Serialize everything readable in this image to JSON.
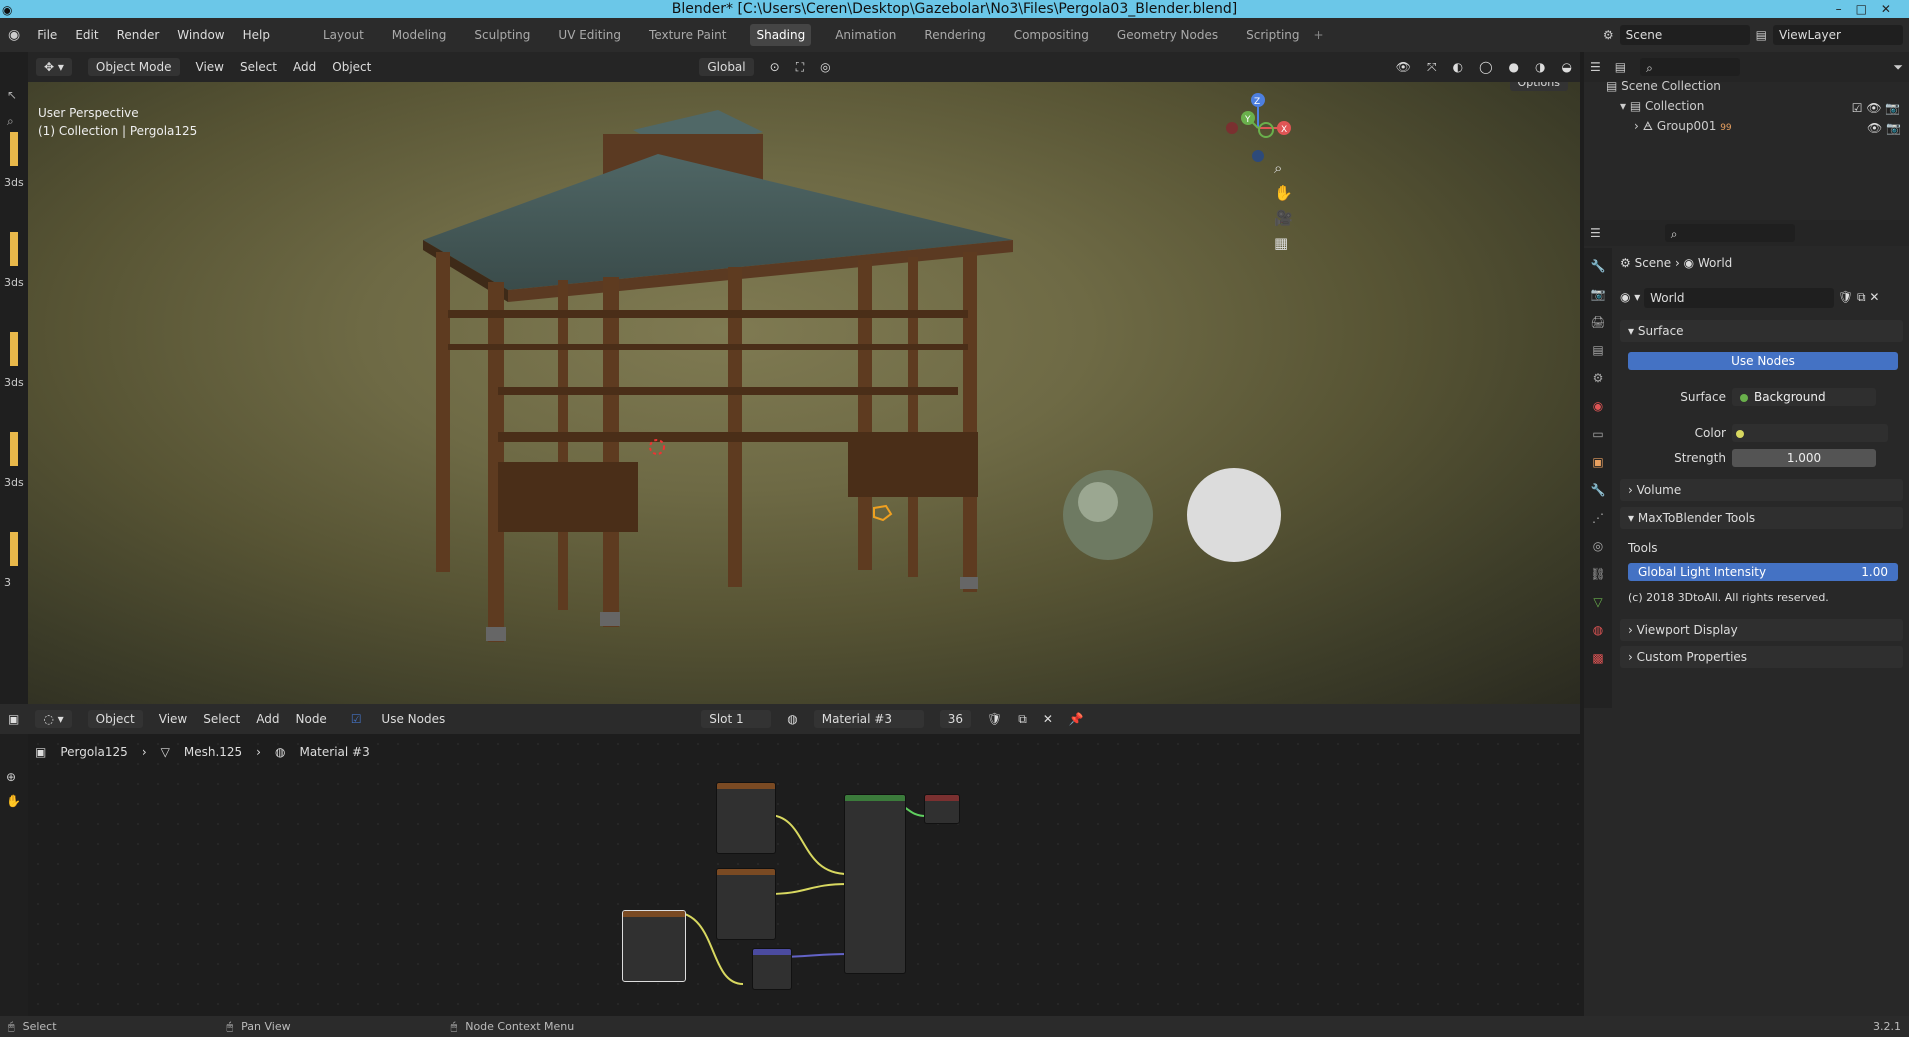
{
  "window": {
    "title": "Blender* [C:\\Users\\Ceren\\Desktop\\Gazebolar\\No3\\Files\\Pergola03_Blender.blend]"
  },
  "menu": {
    "items": [
      "File",
      "Edit",
      "Render",
      "Window",
      "Help"
    ]
  },
  "workspaces": [
    "Layout",
    "Modeling",
    "Sculpting",
    "UV Editing",
    "Texture Paint",
    "Shading",
    "Animation",
    "Rendering",
    "Compositing",
    "Geometry Nodes",
    "Scripting"
  ],
  "active_workspace": "Shading",
  "scene": {
    "label": "Scene",
    "viewlayer": "ViewLayer"
  },
  "viewport_header": {
    "mode": "Object Mode",
    "items": [
      "View",
      "Select",
      "Add",
      "Object"
    ],
    "orientation": "Global",
    "options": "Options"
  },
  "viewport": {
    "perspective": "User Perspective",
    "collection": "(1) Collection | Pergola125"
  },
  "left_labels": [
    "3ds",
    "3ds",
    "3ds",
    "3ds",
    "3"
  ],
  "node_header": {
    "editor_type": "Object",
    "items": [
      "View",
      "Select",
      "Add",
      "Node"
    ],
    "use_nodes": "Use Nodes",
    "slot": "Slot 1",
    "material": "Material #3",
    "users": "36"
  },
  "breadcrumb": {
    "object": "Pergola125",
    "mesh": "Mesh.125",
    "material": "Material #3"
  },
  "outliner": {
    "root": "Scene Collection",
    "collection": "Collection",
    "group": "Group001",
    "group_badge": "99"
  },
  "properties": {
    "breadcrumb": [
      "Scene",
      "World"
    ],
    "world_name": "World",
    "surface_panel": "Surface",
    "use_nodes": "Use Nodes",
    "surface_label": "Surface",
    "surface_value": "Background",
    "color_label": "Color",
    "strength_label": "Strength",
    "strength_value": "1.000",
    "volume_panel": "Volume",
    "tools_panel": "MaxToBlender Tools",
    "tools_label": "Tools",
    "gli_label": "Global Light Intensity",
    "gli_value": "1.00",
    "copyright": "(c) 2018 3DtoAll. All rights reserved.",
    "viewport_display": "Viewport Display",
    "custom_props": "Custom Properties"
  },
  "status": {
    "select": "Select",
    "pan": "Pan View",
    "context": "Node Context Menu",
    "version": "3.2.1"
  },
  "colors": {
    "accent": "#4472c4",
    "active_tab": "#454545",
    "title_bg": "#6bc7e8"
  }
}
